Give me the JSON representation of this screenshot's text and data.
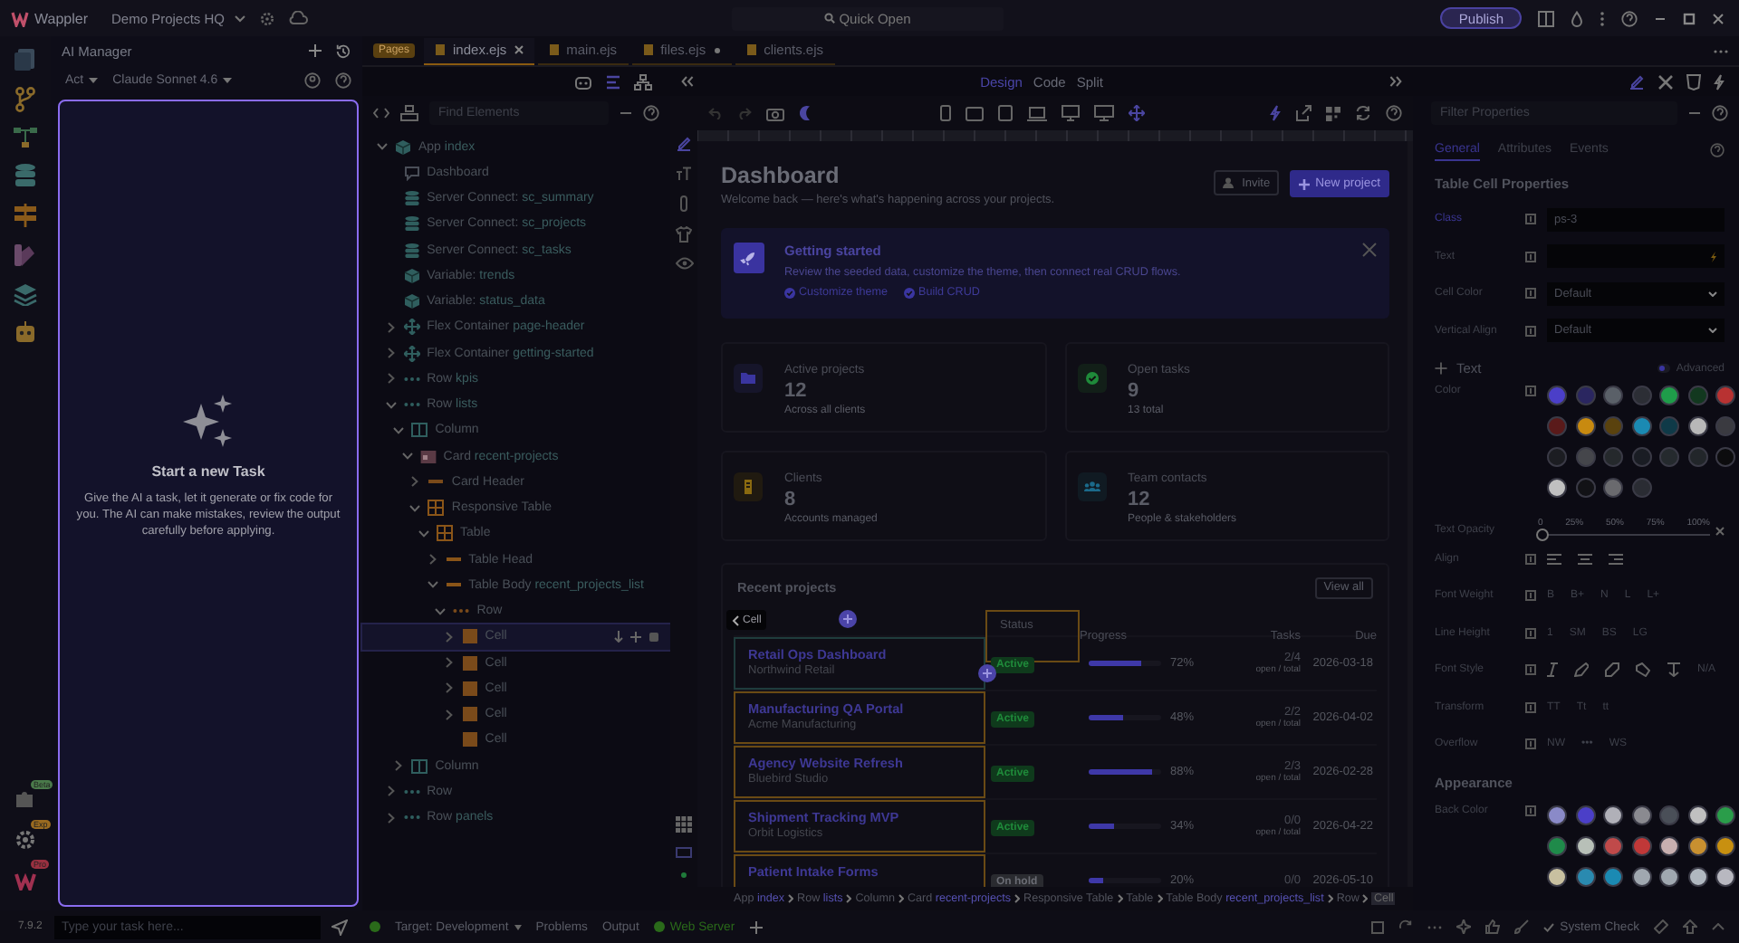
{
  "app": {
    "name": "Wappler",
    "project": "Demo Projects HQ",
    "quick_open": "Quick Open",
    "publish": "Publish"
  },
  "rail_badges": [
    "Beta",
    "Exp",
    "Pro"
  ],
  "ai": {
    "title": "AI Manager",
    "mode": "Act",
    "model": "Claude Sonnet 4.6",
    "empty_title": "Start a new Task",
    "empty_text": "Give the AI a task, let it generate or fix code for you. The AI can make mistakes, review the output carefully before applying.",
    "placeholder": "Type your task here...",
    "version": "7.9.2"
  },
  "pages_label": "Pages",
  "file_tabs": [
    {
      "label": "index.ejs",
      "selected": true,
      "modified": false
    },
    {
      "label": "main.ejs",
      "selected": false,
      "modified": false
    },
    {
      "label": "files.ejs",
      "selected": false,
      "modified": true
    },
    {
      "label": "clients.ejs",
      "selected": false,
      "modified": false
    }
  ],
  "view_modes": [
    {
      "label": "Design",
      "selected": true
    },
    {
      "label": "Code",
      "selected": false
    },
    {
      "label": "Split",
      "selected": false
    }
  ],
  "tree": {
    "placeholder": "Find Elements",
    "items": [
      {
        "kind": "app",
        "label": "App",
        "detail": "index",
        "expanded": true,
        "selected": false,
        "children": [
          {
            "kind": "comment",
            "label": "Dashboard",
            "selected": false
          },
          {
            "kind": "server",
            "label": "Server Connect:",
            "detail": "sc_summary",
            "selected": false
          },
          {
            "kind": "server",
            "label": "Server Connect:",
            "detail": "sc_projects",
            "selected": false
          },
          {
            "kind": "server",
            "label": "Server Connect:",
            "detail": "sc_tasks",
            "selected": false
          },
          {
            "kind": "variable",
            "label": "Variable:",
            "detail": "trends",
            "selected": false
          },
          {
            "kind": "variable",
            "label": "Variable:",
            "detail": "status_data",
            "selected": false
          },
          {
            "kind": "flex",
            "label": "Flex Container",
            "detail": "page-header",
            "expanded": false,
            "selected": false
          },
          {
            "kind": "flex",
            "label": "Flex Container",
            "detail": "getting-started",
            "expanded": false,
            "selected": false
          },
          {
            "kind": "row",
            "label": "Row",
            "detail": "kpis",
            "expanded": false,
            "selected": false
          },
          {
            "kind": "row",
            "label": "Row",
            "detail": "lists",
            "expanded": true,
            "selected": false,
            "children": [
              {
                "kind": "column",
                "label": "Column",
                "expanded": true,
                "selected": false,
                "children": [
                  {
                    "kind": "card",
                    "label": "Card",
                    "detail": "recent-projects",
                    "expanded": true,
                    "selected": false,
                    "children": [
                      {
                        "kind": "header",
                        "label": "Card Header",
                        "expanded": false,
                        "selected": false
                      },
                      {
                        "kind": "table",
                        "label": "Responsive Table",
                        "expanded": true,
                        "selected": false,
                        "children": [
                          {
                            "kind": "table",
                            "label": "Table",
                            "expanded": true,
                            "selected": false,
                            "children": [
                              {
                                "kind": "part",
                                "label": "Table Head",
                                "expanded": false,
                                "selected": false
                              },
                              {
                                "kind": "part",
                                "label": "Table Body",
                                "detail": "recent_projects_list",
                                "expanded": true,
                                "selected": false,
                                "children": [
                                  {
                                    "kind": "row",
                                    "label": "Row",
                                    "expanded": true,
                                    "selected": false,
                                    "children": [
                                      {
                                        "kind": "cell",
                                        "label": "Cell",
                                        "expanded": false,
                                        "selected": true
                                      },
                                      {
                                        "kind": "cell",
                                        "label": "Cell",
                                        "expanded": false,
                                        "selected": false
                                      },
                                      {
                                        "kind": "cell",
                                        "label": "Cell",
                                        "expanded": false,
                                        "selected": false
                                      },
                                      {
                                        "kind": "cell",
                                        "label": "Cell",
                                        "expanded": false,
                                        "selected": false
                                      },
                                      {
                                        "kind": "cell",
                                        "label": "Cell",
                                        "selected": false
                                      }
                                    ]
                                  }
                                ]
                              }
                            ]
                          }
                        ]
                      }
                    ]
                  }
                ]
              },
              {
                "kind": "column",
                "label": "Column",
                "expanded": false,
                "selected": false
              }
            ]
          },
          {
            "kind": "row",
            "label": "Row",
            "expanded": false,
            "selected": false
          },
          {
            "kind": "row",
            "label": "Row",
            "detail": "panels",
            "expanded": false,
            "selected": false
          }
        ]
      }
    ]
  },
  "page": {
    "title": "Dashboard",
    "subtitle": "Welcome back — here's what's happening across your projects.",
    "invite": "Invite",
    "new_project": "New project",
    "banner": {
      "title": "Getting started",
      "text": "Review the seeded data, customize the theme, then connect real CRUD flows.",
      "checks": [
        "Customize theme",
        "Build CRUD"
      ]
    },
    "kpis": [
      {
        "kind": "folder",
        "label": "Active projects",
        "value": "12",
        "sub": "Across all clients"
      },
      {
        "kind": "check",
        "label": "Open tasks",
        "value": "9",
        "sub": "13 total"
      },
      {
        "kind": "building",
        "label": "Clients",
        "value": "8",
        "sub": "Accounts managed"
      },
      {
        "kind": "people",
        "label": "Team contacts",
        "value": "12",
        "sub": "People & stakeholders"
      }
    ],
    "recent": {
      "title": "Recent projects",
      "view_all": "View all",
      "cell_tag": "Cell",
      "columns": [
        "Status",
        "Progress",
        "Tasks",
        "Due"
      ],
      "rows": [
        {
          "name": "Retail Ops Dashboard",
          "client": "Northwind Retail",
          "status": "Active",
          "kind": "active",
          "level": 0.72,
          "percent": "72%",
          "tasks": "2/4",
          "tasks_sub": "open / total",
          "due": "2026-03-18"
        },
        {
          "name": "Manufacturing QA Portal",
          "client": "Acme Manufacturing",
          "status": "Active",
          "kind": "active",
          "level": 0.48,
          "percent": "48%",
          "tasks": "2/2",
          "tasks_sub": "open / total",
          "due": "2026-04-02"
        },
        {
          "name": "Agency Website Refresh",
          "client": "Bluebird Studio",
          "status": "Active",
          "kind": "active",
          "level": 0.88,
          "percent": "88%",
          "tasks": "2/3",
          "tasks_sub": "open / total",
          "due": "2026-02-28"
        },
        {
          "name": "Shipment Tracking MVP",
          "client": "Orbit Logistics",
          "status": "Active",
          "kind": "active",
          "level": 0.34,
          "percent": "34%",
          "tasks": "0/0",
          "tasks_sub": "open / total",
          "due": "2026-04-22"
        },
        {
          "name": "Patient Intake Forms",
          "status": "On hold",
          "kind": "hold",
          "level": 0.2,
          "percent": "20%",
          "tasks": "0/0",
          "due": "2026-05-10"
        }
      ]
    }
  },
  "breadcrumb": [
    {
      "label": "App",
      "detail": "index",
      "selected": false
    },
    {
      "label": "Row",
      "detail": "lists",
      "selected": false
    },
    {
      "label": "Column",
      "selected": false
    },
    {
      "label": "Card",
      "detail": "recent-projects",
      "selected": false
    },
    {
      "label": "Responsive Table",
      "selected": false
    },
    {
      "label": "Table",
      "selected": false
    },
    {
      "label": "Table Body",
      "detail": "recent_projects_list",
      "selected": false
    },
    {
      "label": "Row",
      "selected": false
    },
    {
      "label": "Cell",
      "selected": true
    }
  ],
  "props": {
    "placeholder": "Filter Properties",
    "tabs": [
      {
        "label": "General",
        "selected": true
      },
      {
        "label": "Attributes",
        "selected": false
      },
      {
        "label": "Events",
        "selected": false
      }
    ],
    "title": "Table Cell Properties",
    "fields": [
      {
        "label": "Class",
        "kind": "input",
        "value": "ps-3"
      },
      {
        "label": "Text",
        "kind": "dynamic"
      },
      {
        "label": "Cell Color",
        "kind": "select",
        "value": "Default"
      },
      {
        "label": "Vertical Align",
        "kind": "select",
        "value": "Default"
      }
    ],
    "text_section": "Text",
    "advanced": {
      "label": "Advanced",
      "on": false
    },
    "color_label": "Color",
    "text_colors": [
      {
        "color": "#4b3fc8"
      },
      {
        "color": "#2a2660"
      },
      {
        "color": "#5a6068"
      },
      {
        "color": "#2c2e35"
      },
      {
        "color": "#1f9d4a"
      },
      {
        "color": "#12381f"
      },
      {
        "color": "#b83232"
      },
      {
        "color": "#5a1a1a"
      },
      {
        "color": "#c88a10"
      },
      {
        "color": "#5a420e"
      },
      {
        "color": "#1b8ab3"
      },
      {
        "color": "#0f3a48"
      },
      {
        "color": "#b8b8b8"
      },
      {
        "color": "#3a3a40"
      },
      {
        "color": "#1c1d22"
      },
      {
        "color": "#45464b"
      },
      {
        "color": "#25292c"
      },
      {
        "color": "#1a1d24"
      },
      {
        "color": "#252a2e"
      },
      {
        "color": "#22262a"
      },
      {
        "color": "#0c0c0e"
      },
      {
        "color": "#c0c0c0"
      },
      {
        "color": "#121216"
      },
      {
        "color": "#6a6a6e"
      },
      {
        "color": "#2a2c33"
      }
    ],
    "opacity": {
      "label": "Text Opacity",
      "ticks": [
        "0",
        "25%",
        "50%",
        "75%",
        "100%"
      ],
      "level": 0
    },
    "rows": [
      {
        "label": "Align",
        "kind": "align"
      },
      {
        "label": "Font Weight",
        "kind": "options",
        "options": [
          "B",
          "B+",
          "N",
          "L",
          "L+"
        ]
      },
      {
        "label": "Line Height",
        "kind": "options",
        "options": [
          "1",
          "SM",
          "BS",
          "LG"
        ]
      },
      {
        "label": "Font Style",
        "kind": "style",
        "options": [
          "N/A"
        ]
      },
      {
        "label": "Transform",
        "kind": "options",
        "options": [
          "TT",
          "Tt",
          "tt"
        ]
      },
      {
        "label": "Overflow",
        "kind": "options",
        "options": [
          "NW",
          "•••",
          "WS"
        ]
      }
    ],
    "appearance": "Appearance",
    "back_label": "Back Color",
    "back_colors": [
      {
        "color": "#8a8ac8"
      },
      {
        "color": "#4b3fc8"
      },
      {
        "color": "#b0b0b8"
      },
      {
        "color": "#8a8a90"
      },
      {
        "color": "#4a4f58"
      },
      {
        "color": "#c0c0c0"
      },
      {
        "color": "#2a9d4a"
      },
      {
        "color": "#1f8a4a"
      },
      {
        "color": "#b8c0b8"
      },
      {
        "color": "#c04a4a"
      },
      {
        "color": "#c03838"
      },
      {
        "color": "#c8b0b0"
      },
      {
        "color": "#c89030"
      },
      {
        "color": "#c89010"
      },
      {
        "color": "#c8c0a0"
      },
      {
        "color": "#2a8ab0"
      },
      {
        "color": "#1b8ab3"
      },
      {
        "color": "#a0a8b0"
      },
      {
        "color": "#a0a8b0"
      },
      {
        "color": "#b0b8c0"
      },
      {
        "color": "#b8b8c0"
      }
    ]
  },
  "status": {
    "target": "Target: Development",
    "problems": "Problems",
    "output": "Output",
    "server": "Web Server",
    "system_check": "System Check"
  }
}
